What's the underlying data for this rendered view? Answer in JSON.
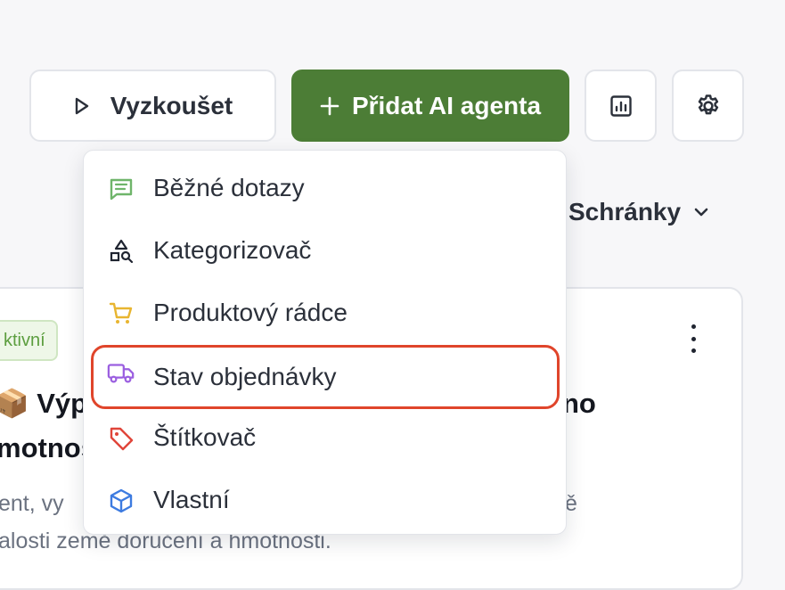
{
  "toolbar": {
    "try_label": "Vyzkoušet",
    "add_agent_label": "Přidat AI agenta"
  },
  "filter": {
    "label": "Schránky"
  },
  "menu": {
    "items": [
      {
        "label": "Běžné dotazy",
        "icon": "chat-icon"
      },
      {
        "label": "Kategorizovač",
        "icon": "shapes-search-icon"
      },
      {
        "label": "Produktový rádce",
        "icon": "cart-icon"
      },
      {
        "label": "Stav objednávky",
        "icon": "truck-icon"
      },
      {
        "label": "Štítkovač",
        "icon": "tag-icon"
      },
      {
        "label": "Vlastní",
        "icon": "cube-icon"
      }
    ]
  },
  "card": {
    "badge": "ktivní",
    "title_line1": "📦 Výpo",
    "title_line2": "motnos",
    "title_right": "no",
    "desc_line1": "ent, vy",
    "desc_line2": "alosti země doručení a hmotnosti.",
    "desc_right": "ě"
  },
  "colors": {
    "primary": "#4c7d36",
    "highlight_border": "#e0452b",
    "badge_text": "#5c9e3f"
  }
}
